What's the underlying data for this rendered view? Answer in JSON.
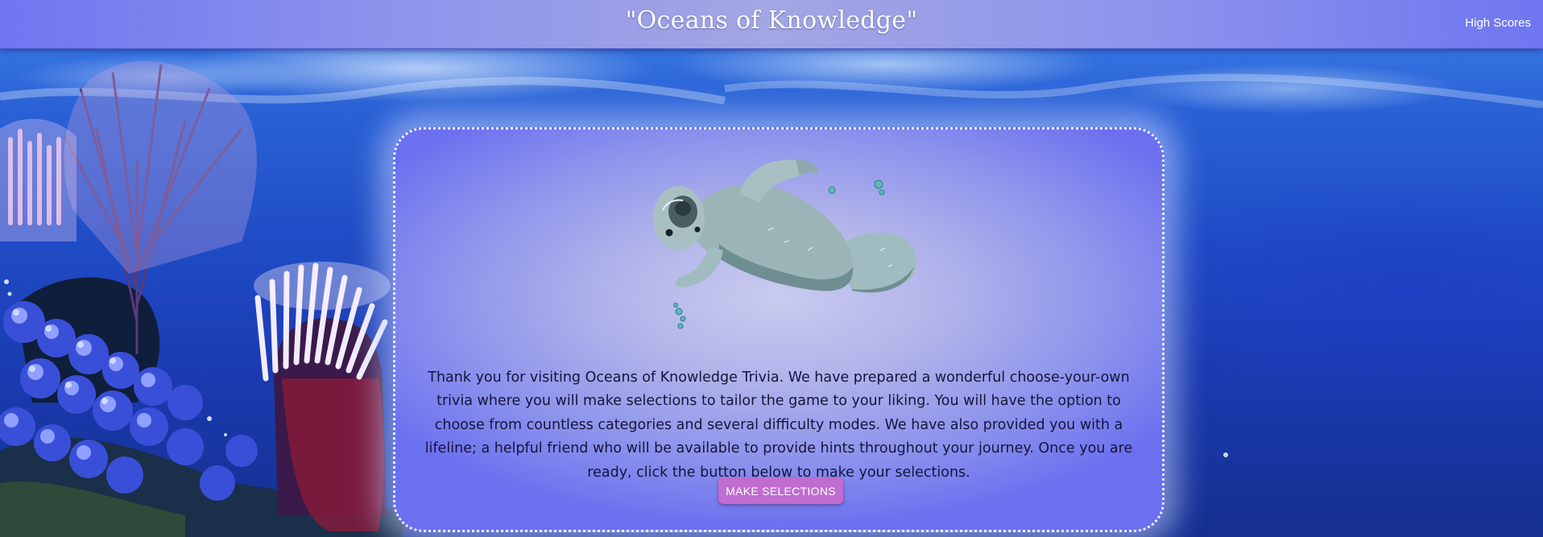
{
  "header": {
    "title": "\"Oceans of Knowledge\"",
    "high_scores_label": "High Scores"
  },
  "main": {
    "intro_text": "Thank you for visiting Oceans of Knowledge Trivia. We have prepared a wonderful choose-your-own trivia where you will make selections to tailor the game to your liking. You will have the option to choose from countless categories and several difficulty modes. We have also provided you with a lifeline; a helpful friend who will be available to provide hints throughout your journey. Once you are ready, click the button below to make your selections.",
    "button_label": "MAKE SELECTIONS",
    "mascot_icon": "manatee-icon"
  },
  "colors": {
    "header_accent": "#8c93ec",
    "button": "#c06cd0",
    "ocean": "#1f4cc6"
  }
}
